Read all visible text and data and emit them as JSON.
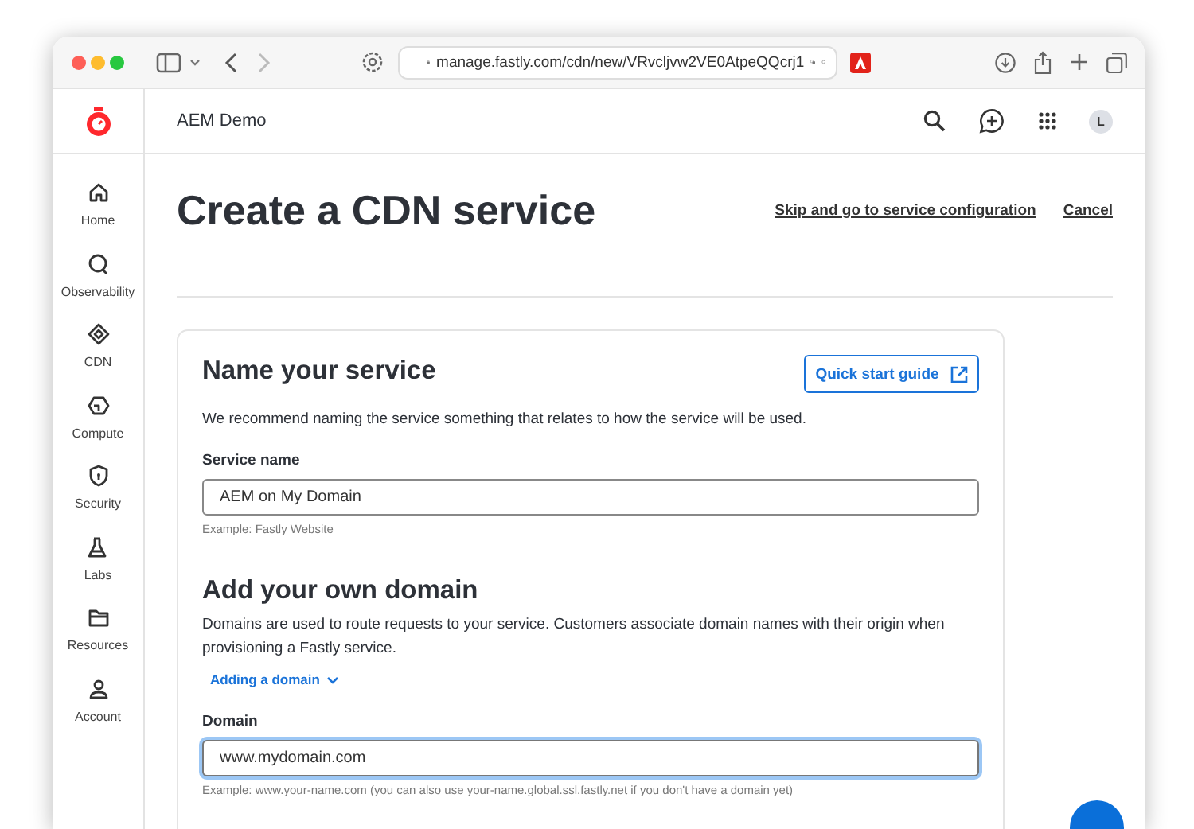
{
  "browser": {
    "url": "manage.fastly.com/cdn/new/VRvcljvw2VE0AtpeQQcrj1"
  },
  "header": {
    "workspace": "AEM Demo",
    "avatar": "L"
  },
  "sidebar": {
    "items": [
      {
        "label": "Home"
      },
      {
        "label": "Observability"
      },
      {
        "label": "CDN"
      },
      {
        "label": "Compute"
      },
      {
        "label": "Security"
      },
      {
        "label": "Labs"
      },
      {
        "label": "Resources"
      },
      {
        "label": "Account"
      }
    ]
  },
  "page": {
    "title": "Create a CDN service",
    "links": [
      "Skip and go to service configuration",
      "Cancel"
    ]
  },
  "card": {
    "sections": [
      {
        "heading": "Name your service",
        "button": "Quick start guide",
        "description": "We recommend naming the service something that relates to how the service will be used.",
        "field": {
          "label": "Service name",
          "value": "AEM on My Domain",
          "hint": "Example: Fastly Website",
          "focused": false
        }
      },
      {
        "heading": "Add your own domain",
        "description": "Domains are used to route requests to your service. Customers associate domain names with their origin when provisioning a Fastly service.",
        "disclosure": "Adding a domain",
        "field": {
          "label": "Domain",
          "value": "www.mydomain.com",
          "hint": "Example: www.your-name.com (you can also use your-name.global.ssl.fastly.net if you don't have a domain yet)",
          "focused": true
        }
      }
    ]
  }
}
